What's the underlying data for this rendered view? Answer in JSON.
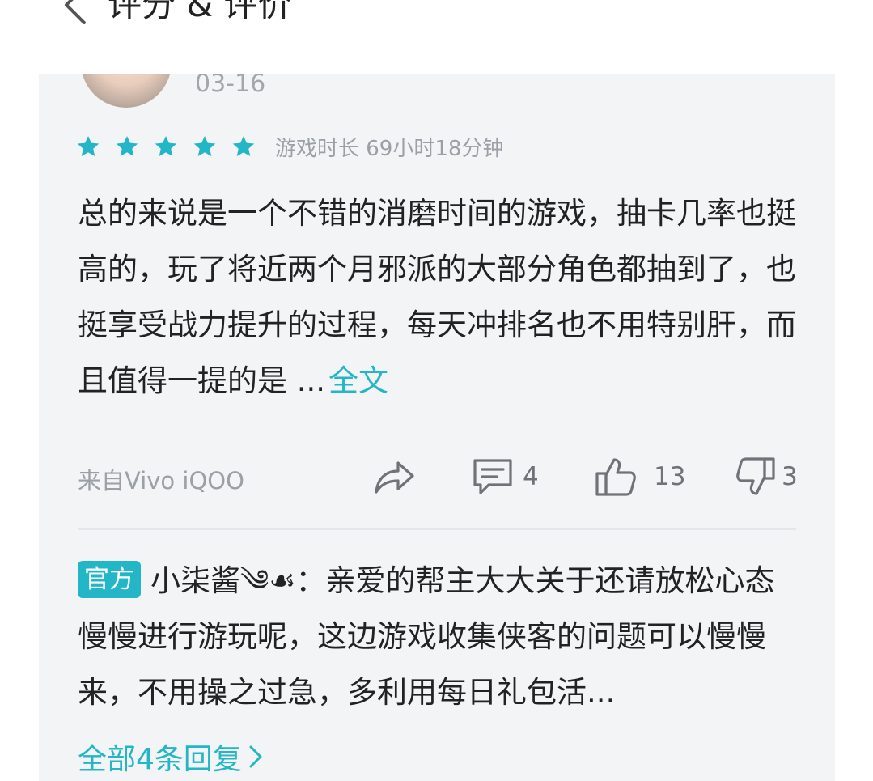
{
  "header": {
    "title": "评分 & 评价"
  },
  "review": {
    "date": "03-16",
    "rating_stars": 5,
    "playtime": "游戏时长 69小时18分钟",
    "body": "总的来说是一个不错的消磨时间的游戏，抽卡几率也挺高的，玩了将近两个月邪派的大部分角色都抽到了，也挺享受战力提升的过程，每天冲排名也不用特别肝，而且值得一提的是 ...",
    "full_text_link": "全文",
    "device": "来自Vivo iQOO",
    "comments_count": "4",
    "likes_count": "13",
    "dislikes_count": "3"
  },
  "reply": {
    "badge": "官方",
    "author": "小柒酱༄☙",
    "separator": "：",
    "text": "亲爱的帮主大大关于还请放松心态慢慢进行游玩呢，这边游戏收集侠客的问题可以慢慢来，不用操之过急，多利用每日礼包活...",
    "all_replies": "全部4条回复"
  },
  "colors": {
    "accent": "#22b6c7",
    "card_bg": "#f3f4f6",
    "text": "#222222",
    "muted": "#9aa0a6"
  },
  "icons": {
    "back": "chevron-left-icon",
    "star": "star-icon",
    "share": "share-icon",
    "comment": "comment-icon",
    "like": "thumbs-up-icon",
    "dislike": "thumbs-down-icon",
    "more": "chevron-right-icon"
  }
}
